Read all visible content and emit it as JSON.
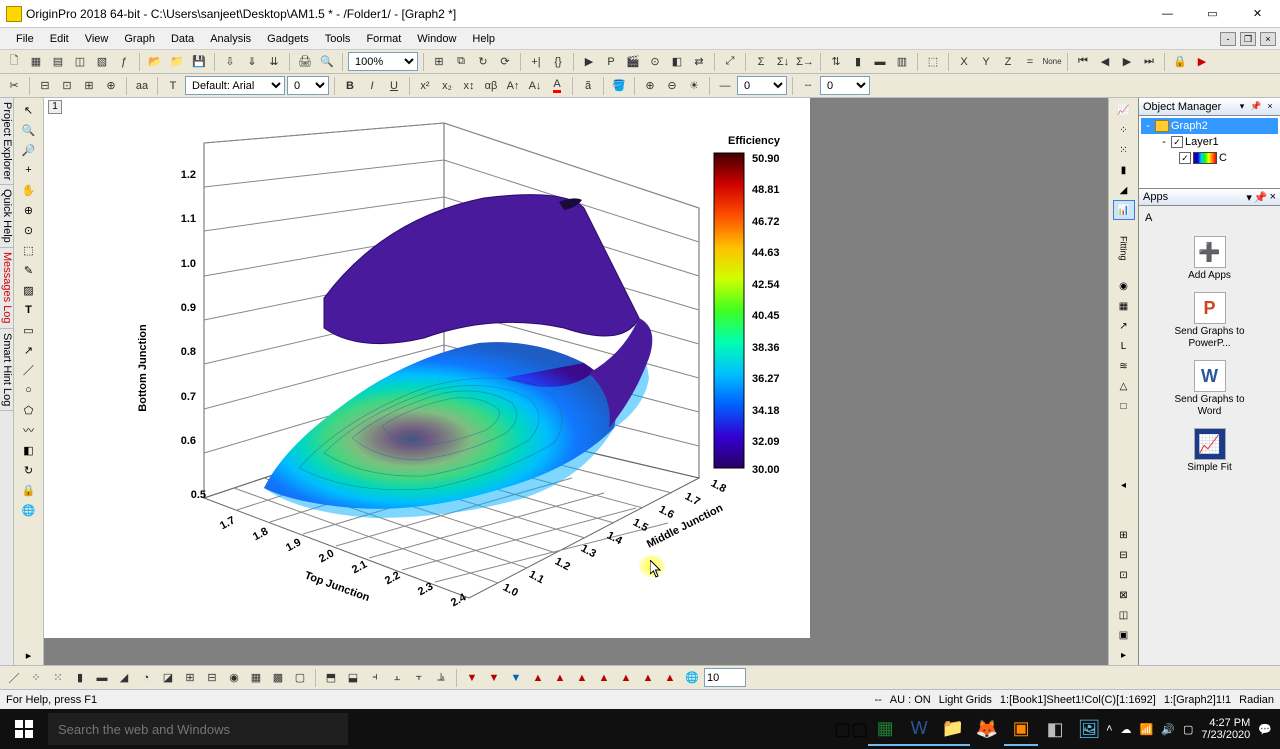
{
  "window": {
    "title": "OriginPro 2018 64-bit - C:\\Users\\sanjeet\\Desktop\\AM1.5 * - /Folder1/ - [Graph2 *]"
  },
  "menu": [
    "File",
    "Edit",
    "View",
    "Graph",
    "Data",
    "Analysis",
    "Gadgets",
    "Tools",
    "Format",
    "Window",
    "Help"
  ],
  "toolbar1": {
    "zoom": "100%"
  },
  "toolbar2": {
    "font_name": "Default: Arial",
    "font_size": "0",
    "line_width": "0",
    "value2": "0"
  },
  "left_tabs": [
    "Project Explorer",
    "Quick Help",
    "Messages Log",
    "Smart Hint Log"
  ],
  "graph": {
    "layer_badge": "1",
    "colorbar_title": "Efficiency",
    "z_label": "Bottom Junction",
    "x_label": "Top Junction",
    "y_label": "Middle Junction",
    "z_ticks": [
      "1.2",
      "1.1",
      "1.0",
      "0.9",
      "0.8",
      "0.7",
      "0.6",
      "0.5"
    ],
    "colorbar_ticks": [
      "50.90",
      "48.81",
      "46.72",
      "44.63",
      "42.54",
      "40.45",
      "38.36",
      "36.27",
      "34.18",
      "32.09",
      "30.00"
    ],
    "x_ticks": [
      "1.7",
      "1.8",
      "1.9",
      "2.0",
      "2.1",
      "2.2",
      "2.3",
      "2.4"
    ],
    "y_ticks": [
      "1.0",
      "1.1",
      "1.2",
      "1.3",
      "1.4",
      "1.5",
      "1.6",
      "1.7",
      "1.8"
    ]
  },
  "chart_data": {
    "type": "surface3d",
    "title": "Efficiency",
    "xlabel": "Top Junction",
    "ylabel": "Middle Junction",
    "zlabel": "Bottom Junction",
    "x_range": [
      1.7,
      2.4
    ],
    "y_range": [
      1.0,
      1.8
    ],
    "z_range": [
      0.5,
      1.2
    ],
    "color_axis": "Efficiency",
    "color_range": [
      30.0,
      50.9
    ],
    "colorbar_ticks": [
      30.0,
      32.09,
      34.18,
      36.27,
      38.36,
      40.45,
      42.54,
      44.63,
      46.72,
      48.81,
      50.9
    ],
    "colormap": [
      "#2a0066",
      "#3200d0",
      "#0040ff",
      "#00a0ff",
      "#00ffc0",
      "#30ff30",
      "#c0ff00",
      "#ffe000",
      "#ff8000",
      "#ff2000",
      "#a00000",
      "#400000"
    ],
    "note": "3D colormap surface; peak efficiency (~50) near Top≈2.0, Middle≈1.3 at Z≈0.8; surface rises toward Z≈1.15 at upper-right with lower efficiency (~32)."
  },
  "object_manager": {
    "title": "Object Manager",
    "root": "Graph2",
    "layer": "Layer1",
    "series": "C"
  },
  "apps": {
    "title": "Apps",
    "items": [
      {
        "label": "Add Apps",
        "icon": "➕"
      },
      {
        "label": "Send Graphs to PowerP...",
        "icon": "P"
      },
      {
        "label": "Send Graphs to Word",
        "icon": "W"
      },
      {
        "label": "Simple Fit",
        "icon": "📈"
      }
    ]
  },
  "bottom_toolbar": {
    "spin_value": "10"
  },
  "statusbar": {
    "left": "For Help, press F1",
    "items": [
      "--",
      "AU : ON",
      "Light Grids",
      "1:[Book1]Sheet1!Col(C)[1:1692]",
      "1:[Graph2]1!1",
      "Radian"
    ]
  },
  "taskbar": {
    "search_placeholder": "Search the web and Windows",
    "time": "4:27 PM",
    "date": "7/23/2020"
  }
}
